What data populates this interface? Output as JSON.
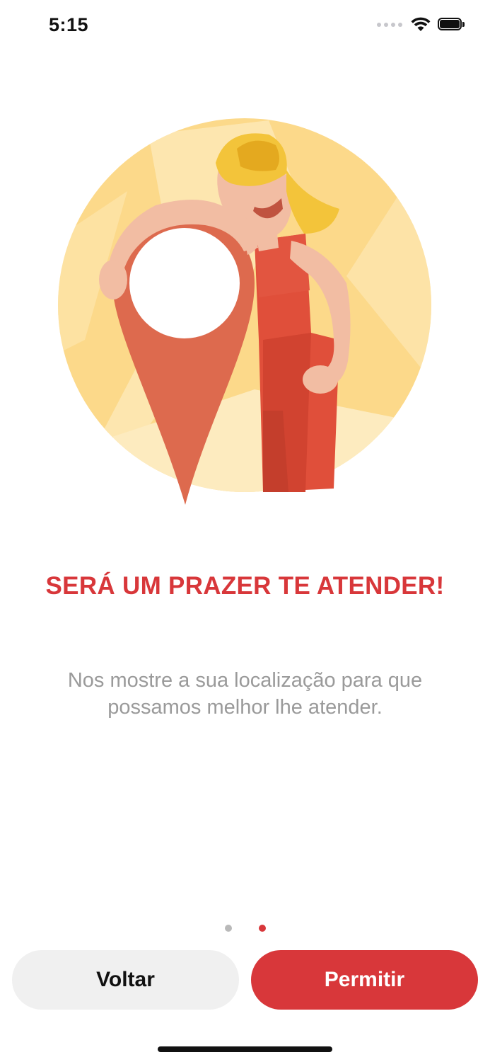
{
  "status_bar": {
    "time": "5:15",
    "icons": [
      "cellular-signal-icon",
      "wifi-icon",
      "battery-icon"
    ]
  },
  "illustration": {
    "description_icon": "woman-holding-location-pin-illustration",
    "colors": {
      "circle_bg": "#fcd98a",
      "circle_light": "#fde9b8",
      "pin": "#dd6a4e",
      "dress": "#e04f3a",
      "skin": "#f2bda3",
      "hair": "#f3c43a"
    }
  },
  "content": {
    "headline": "SERÁ UM PRAZER TE ATENDER!",
    "description": "Nos mostre a sua localização para que possamos melhor lhe atender."
  },
  "pager": {
    "total": 2,
    "current": 2
  },
  "buttons": {
    "back_label": "Voltar",
    "allow_label": "Permitir"
  },
  "colors": {
    "accent": "#d8373a",
    "secondary_button_bg": "#f0f0f0",
    "body_text": "#9a9a9a"
  }
}
